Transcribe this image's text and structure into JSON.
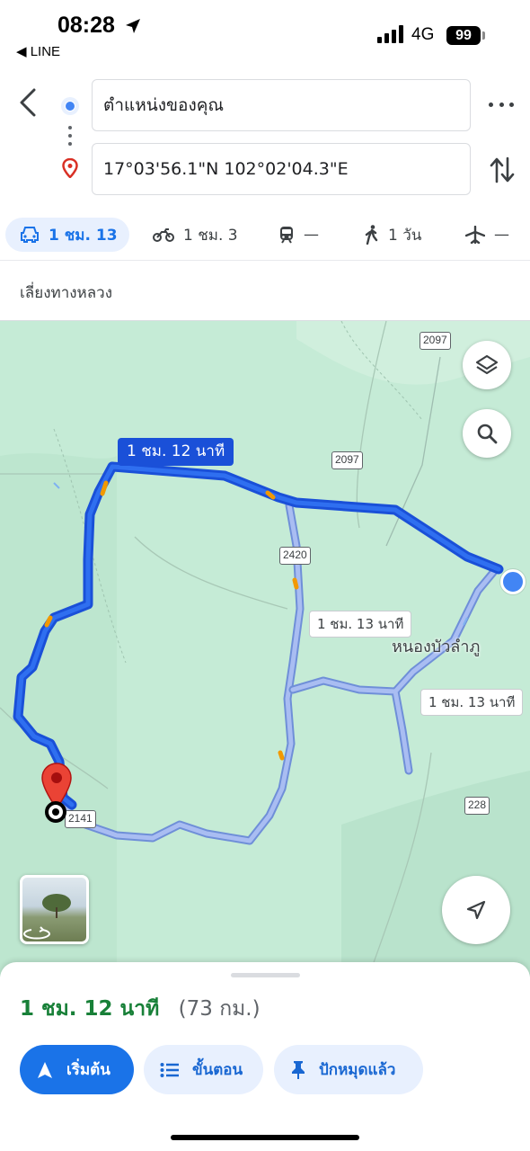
{
  "status_bar": {
    "time": "08:28",
    "back_app": "◀ LINE",
    "network": "4G",
    "battery": "99"
  },
  "directions": {
    "from": "ตำแหน่งของคุณ",
    "to": "17°03'56.1\"N 102°02'04.3\"E"
  },
  "modes": [
    {
      "name": "car",
      "label": "1 ชม. 13",
      "selected": true
    },
    {
      "name": "motorcycle",
      "label": "1 ชม. 3"
    },
    {
      "name": "transit",
      "label": "—"
    },
    {
      "name": "walk",
      "label": "1 วัน"
    },
    {
      "name": "flight",
      "label": "—"
    }
  ],
  "options": {
    "avoid_label": "เลี่ยงทางหลวง"
  },
  "map": {
    "road_shields": [
      "2097",
      "2097",
      "2420",
      "228",
      "2141"
    ],
    "selected_route_label": "1 ชม. 12 นาที",
    "alt_route_labels": [
      "1 ชม. 13 นาที",
      "1 ชม. 13 นาที"
    ],
    "town_name": "หนองบัวลำภู",
    "colors": {
      "selected_route": "#1a50d8",
      "alt_route": "#a9bdf2",
      "map_land": "#c5ebd6"
    }
  },
  "summary": {
    "duration": "1 ชม. 12 นาที",
    "distance": "(73 กม.)"
  },
  "actions": {
    "start": "เริ่มต้น",
    "steps": "ขั้นตอน",
    "pinned": "ปักหมุดแล้ว"
  }
}
